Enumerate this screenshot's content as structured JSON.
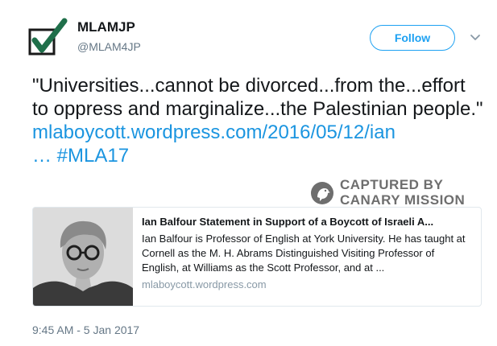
{
  "user": {
    "display_name": "MLAMJP",
    "handle": "@MLAM4JP",
    "avatar_icon": "checkmark-icon",
    "follow_label": "Follow",
    "menu_icon": "chevron-down-icon"
  },
  "tweet": {
    "text": "\"Universities...cannot be divorced...from the...effort to oppress and marginalize...the Palestinian people.\"",
    "link": "mlaboycott.wordpress.com/2016/05/12/ian",
    "link_ellipsis": "…",
    "hashtag": "#MLA17",
    "timestamp": "9:45 AM - 5 Jan 2017"
  },
  "card": {
    "title": "Ian Balfour Statement in Support of a Boycott of Israeli A...",
    "description": "Ian Balfour is Professor of English at York University. He has taught at Cornell as the M. H. Abrams Distinguished Visiting Professor of English, at Williams as the Scott Professor, and at ...",
    "domain": "mlaboycott.wordpress.com",
    "image_icon": "portrait-photo"
  },
  "watermark": {
    "line1": "CAPTURED BY",
    "line2": "CANARY MISSION",
    "icon": "canary-bird-icon"
  },
  "colors": {
    "link": "#1b95e0",
    "follow": "#1da1f2",
    "secondary_text": "#657786",
    "watermark": "#6e6e6e"
  }
}
